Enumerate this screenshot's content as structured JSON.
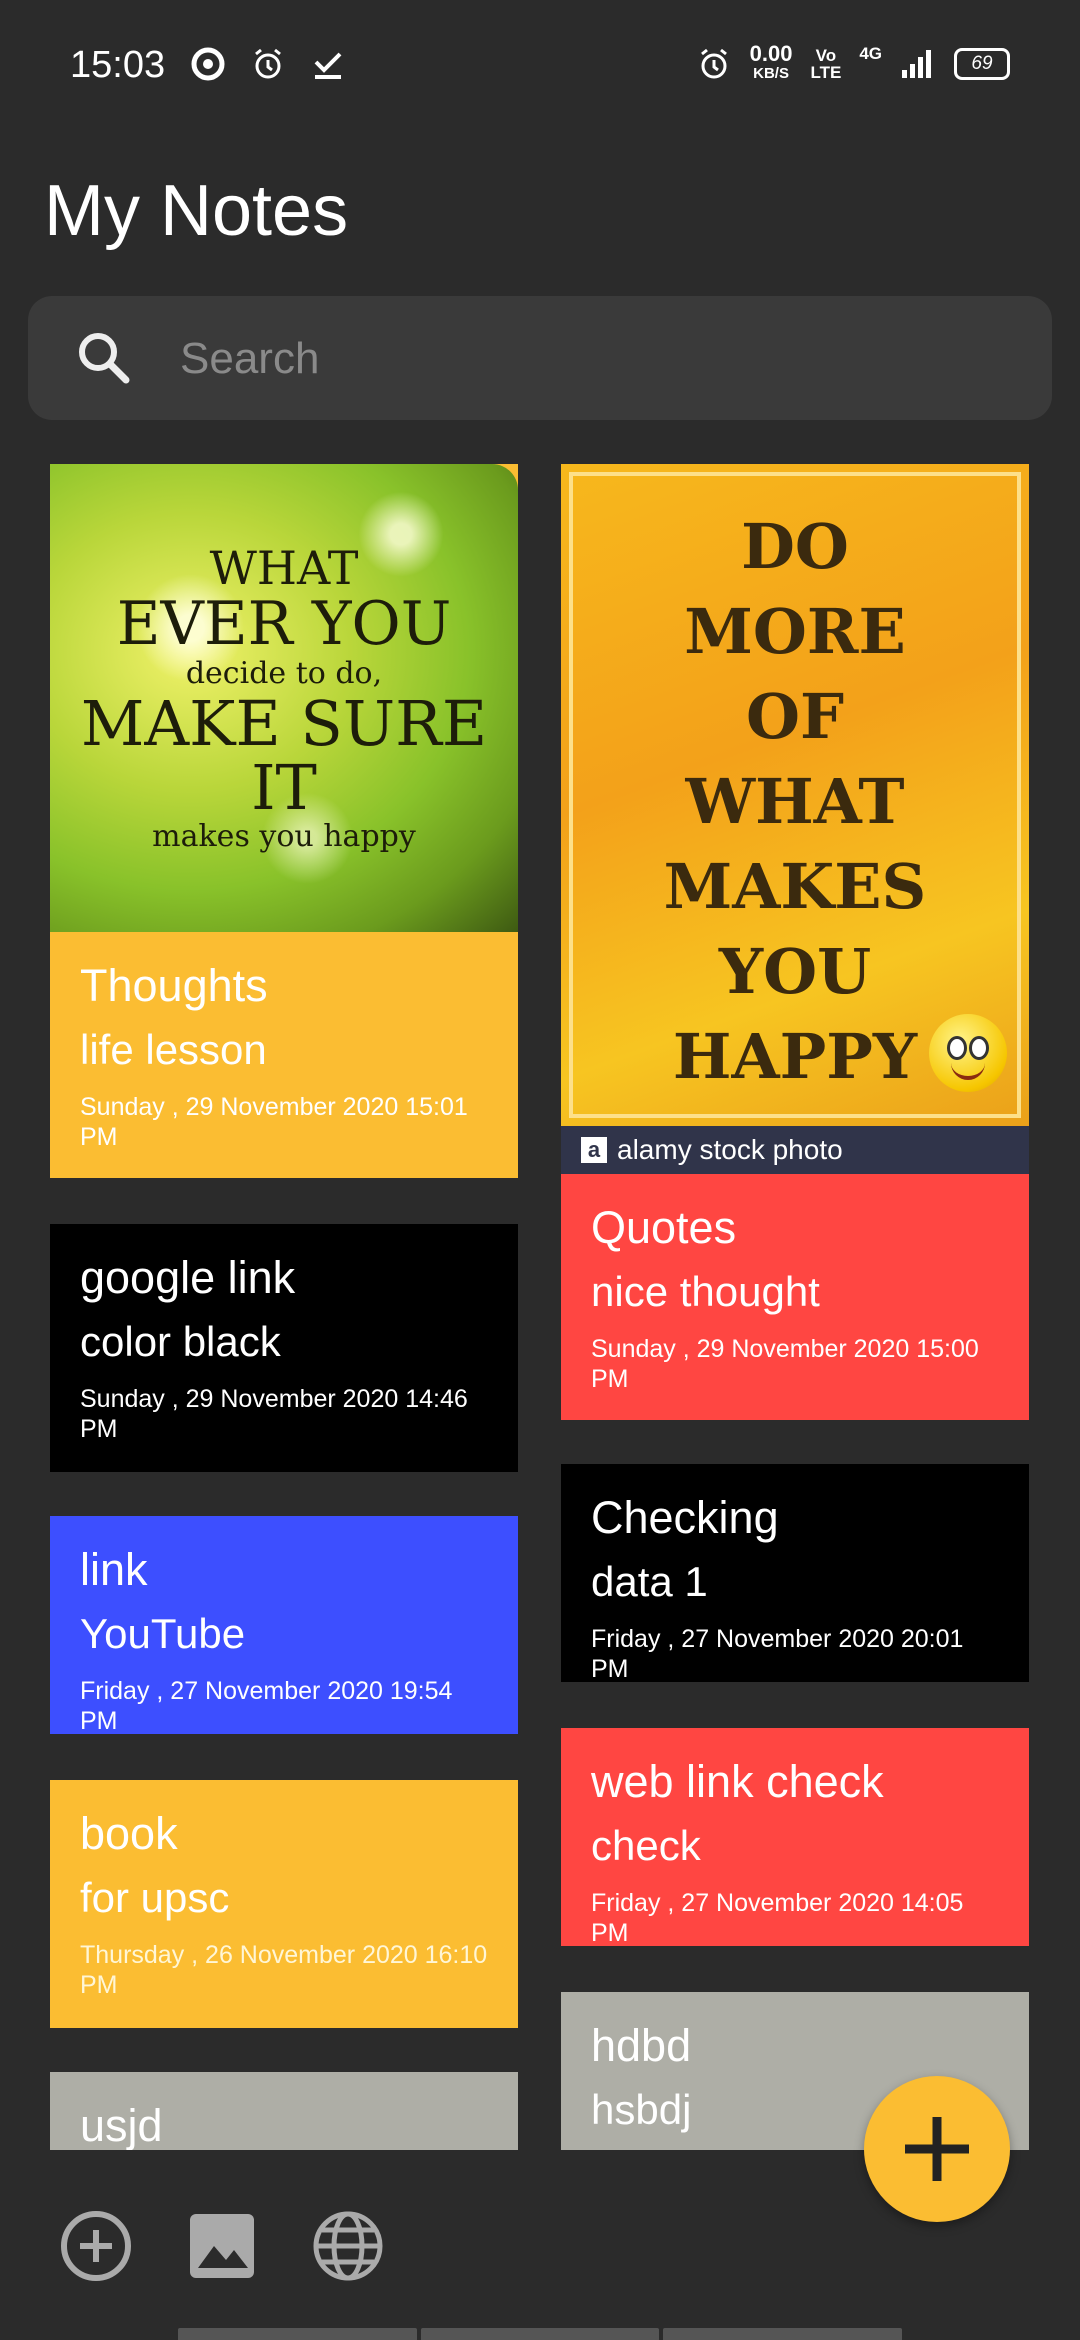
{
  "status_bar": {
    "time": "15:03",
    "net_speed": "0.00",
    "net_unit": "KB/S",
    "volte_top": "Vo",
    "volte_bottom": "LTE",
    "network": "4G",
    "battery": "69",
    "left_icons": [
      "sync-icon",
      "alarm-icon",
      "check-icon"
    ],
    "right_icons": [
      "alarm-icon",
      "signal-icon",
      "battery-icon"
    ]
  },
  "page": {
    "title": "My Notes"
  },
  "search": {
    "placeholder": "Search",
    "value": ""
  },
  "notes": [
    {
      "id": "thoughts",
      "image_text": [
        "WHAT",
        "EVER YOU",
        "decide to do,",
        "MAKE SURE IT",
        "makes you happy"
      ],
      "title": "Thoughts",
      "subtitle": "life lesson",
      "date": "Sunday , 29 November 2020 15:01 PM",
      "color": "#fbbd32"
    },
    {
      "id": "quotes",
      "image_text": [
        "DO",
        "MORE",
        "OF",
        "WHAT",
        "MAKES",
        "YOU",
        "HAPPY"
      ],
      "watermark": "alamy stock photo",
      "watermark_logo": "a",
      "title": "Quotes",
      "subtitle": "nice thought",
      "date": "Sunday , 29 November 2020 15:00 PM",
      "color": "#ff4642"
    },
    {
      "id": "google-link",
      "title": "google link",
      "subtitle": "color black",
      "date": "Sunday , 29 November 2020 14:46 PM",
      "color": "#000000"
    },
    {
      "id": "checking",
      "title": "Checking",
      "subtitle": "data 1",
      "date": "Friday , 27 November 2020 20:01 PM",
      "color": "#000000"
    },
    {
      "id": "link",
      "title": "link",
      "subtitle": "YouTube",
      "date": "Friday , 27 November 2020 19:54 PM",
      "color": "#3d4fff"
    },
    {
      "id": "web-link-check",
      "title": "web link check",
      "subtitle": "check",
      "date": "Friday , 27 November 2020 14:05 PM",
      "color": "#ff4642"
    },
    {
      "id": "book",
      "title": "book",
      "subtitle": "for upsc",
      "date": "Thursday , 26 November 2020 16:10 PM",
      "color": "#fbbd32"
    },
    {
      "id": "hdbd",
      "title": "hdbd",
      "subtitle": "hsbdj",
      "color": "#aeaea6"
    },
    {
      "id": "usjd",
      "title": "usjd",
      "color": "#aeaea6"
    }
  ],
  "fab": {
    "icon": "plus-icon",
    "color": "#fbbd32"
  },
  "bottom_bar": {
    "icons": [
      "add-circle-icon",
      "image-icon",
      "globe-icon"
    ]
  }
}
